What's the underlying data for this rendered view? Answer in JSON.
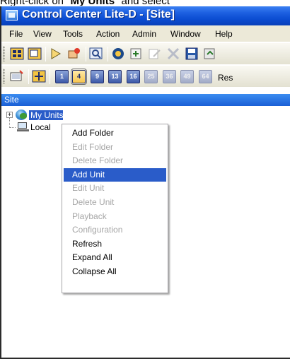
{
  "caption": {
    "prefix": "Right-click on \"",
    "bold": "My Units",
    "suffix": "\" and select"
  },
  "window": {
    "title": "Control Center Lite-D - [Site]"
  },
  "menu": [
    {
      "label": "File"
    },
    {
      "label": "View"
    },
    {
      "label": "Tools"
    },
    {
      "label": "Action"
    },
    {
      "label": "Admin"
    },
    {
      "label": "Window"
    },
    {
      "label": "Help"
    }
  ],
  "toolbar1": {
    "icons": [
      "layout-icon",
      "monitor-icon",
      "play-icon",
      "hand-icon",
      "search-icon",
      "camera-icon",
      "add-icon",
      "edit-icon",
      "delete-icon",
      "save-icon",
      "connect-icon"
    ]
  },
  "toolbar2": {
    "icons": [
      "display-icon",
      "fullscreen-icon"
    ],
    "layouts": [
      "1",
      "4",
      "9",
      "13",
      "16",
      "25",
      "36",
      "49",
      "64"
    ],
    "active_layout": "4",
    "truncated_label": "Res"
  },
  "site": {
    "header": "Site",
    "nodes": [
      {
        "label": "My Units",
        "selected": true,
        "icon": "globe-icon"
      },
      {
        "label": "Local",
        "selected": false,
        "icon": "computer-icon"
      }
    ]
  },
  "context_menu": {
    "items": [
      {
        "label": "Add Folder",
        "enabled": true
      },
      {
        "label": "Edit Folder",
        "enabled": false
      },
      {
        "label": "Delete Folder",
        "enabled": false
      },
      {
        "label": "Add Unit",
        "enabled": true,
        "highlighted": true
      },
      {
        "label": "Edit Unit",
        "enabled": false
      },
      {
        "label": "Delete Unit",
        "enabled": false
      },
      {
        "label": "Playback",
        "enabled": false
      },
      {
        "label": "Configuration",
        "enabled": false
      },
      {
        "label": "Refresh",
        "enabled": true
      },
      {
        "label": "Expand All",
        "enabled": true
      },
      {
        "label": "Collapse All",
        "enabled": true
      }
    ]
  },
  "colors": {
    "titlebar": "#0a4bd0",
    "selection": "#2a5cc9",
    "menubar": "#ece9d8",
    "disabled_text": "#a6a6a6"
  }
}
